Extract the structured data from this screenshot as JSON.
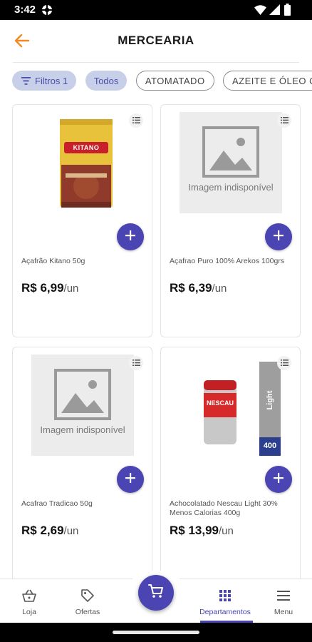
{
  "status_bar": {
    "time": "3:42",
    "icons": [
      "app-notification-icon",
      "wifi-icon",
      "signal-icon",
      "battery-icon"
    ]
  },
  "app_bar": {
    "title": "MERCEARIA",
    "back_icon": "arrow-left-icon"
  },
  "filters": {
    "filter_chip": "Filtros 1",
    "chips": [
      "Todos",
      "ATOMATADO",
      "AZEITE E ÓLEO C"
    ]
  },
  "products": [
    {
      "name": "Açafrão Kitano 50g",
      "price": "R$ 6,99",
      "unit": "/un",
      "image": "kitano-package",
      "package_brand": "KITANO"
    },
    {
      "name": "Açafrao Puro 100% Arekos 100grs",
      "price": "R$ 6,39",
      "unit": "/un",
      "image": "placeholder",
      "placeholder_text": "Imagem indisponível"
    },
    {
      "name": "Acafrao Tradicao 50g",
      "price": "R$ 2,69",
      "unit": "/un",
      "image": "placeholder",
      "placeholder_text": "Imagem indisponível"
    },
    {
      "name": "Achocolatado Nescau Light 30% Menos Calorias 400g",
      "price": "R$ 13,99",
      "unit": "/un",
      "image": "nescau-can",
      "package_brand": "NESCAU",
      "package_tag": "Light",
      "package_weight": "400"
    }
  ],
  "bottom_nav": {
    "items": [
      {
        "label": "Loja",
        "icon": "shopping-basket-icon"
      },
      {
        "label": "Ofertas",
        "icon": "tag-icon"
      },
      {
        "label": "Departamentos",
        "icon": "grid-icon",
        "active": true
      },
      {
        "label": "Menu",
        "icon": "hamburger-menu-icon"
      }
    ],
    "cart_icon": "shopping-cart-icon"
  },
  "colors": {
    "primary": "#4a45b2",
    "accent_orange": "#f08a24",
    "chip_active_bg": "#c8cfe8"
  }
}
